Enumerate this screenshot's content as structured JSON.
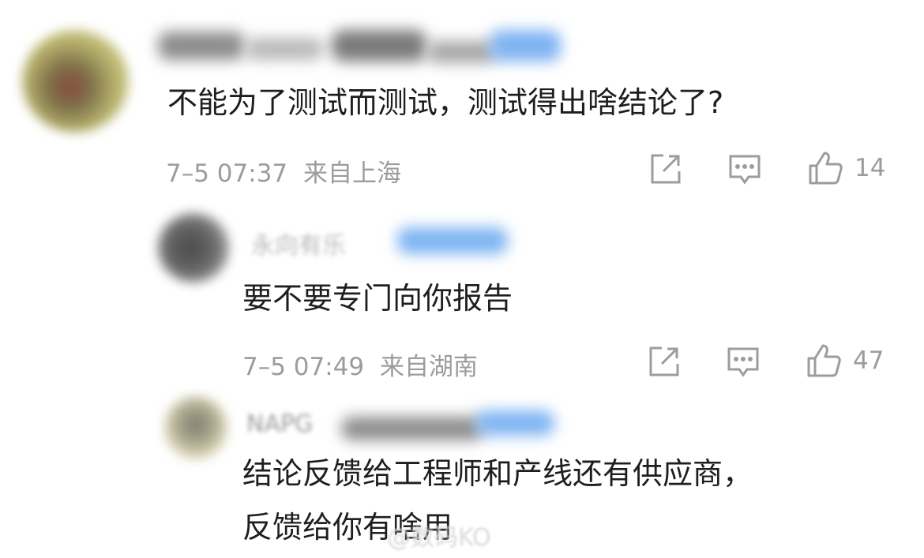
{
  "comments": [
    {
      "text": "不能为了测试而测试，测试得出啥结论了?",
      "time": "7–5 07:37",
      "location": "来自上海",
      "likes": "14"
    },
    {
      "username_partial": "永向有乐",
      "text": "要不要专门向你报告",
      "time": "7–5 07:49",
      "location": "来自湖南",
      "likes": "47"
    },
    {
      "username_partial": "NAPG",
      "text_line1": "结论反馈给工程师和产线还有供应商，",
      "text_line2": "反馈给你有啥用"
    }
  ],
  "icons": [
    "share-icon",
    "comment-icon",
    "like-icon"
  ],
  "watermark": "@数码KO",
  "colors": {
    "meta_gray": "#9c9c9c",
    "text": "#1e1e1e",
    "blur_blue": "#7fb4f2"
  }
}
